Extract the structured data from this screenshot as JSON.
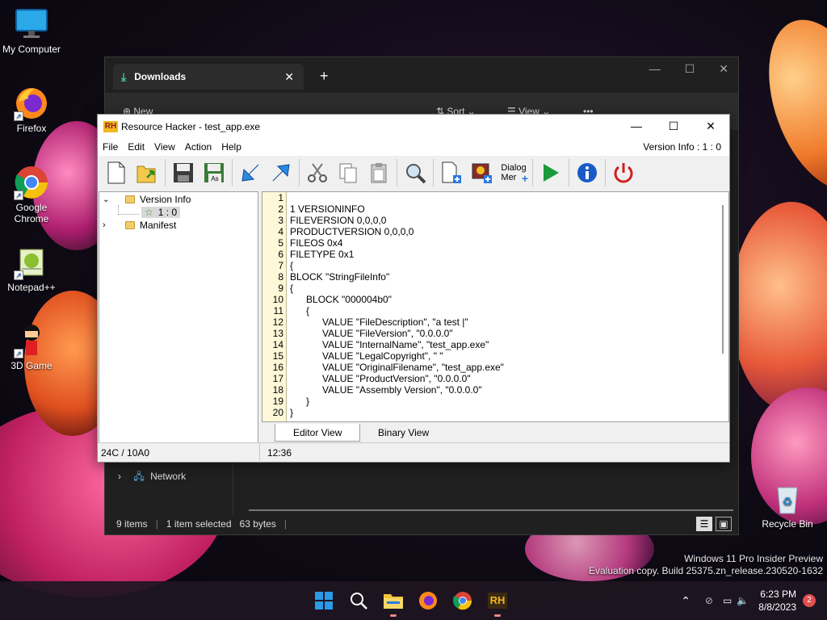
{
  "desktop": {
    "icons": [
      {
        "label": "My Computer"
      },
      {
        "label": "Firefox"
      },
      {
        "label": "Google Chrome"
      },
      {
        "label": "Notepad++"
      },
      {
        "label": "3D Game"
      },
      {
        "label": "Recycle Bin"
      }
    ],
    "watermark": {
      "line1": "Windows 11 Pro Insider Preview",
      "line2": "Evaluation copy. Build 25375.zn_release.230520-1632"
    }
  },
  "explorer": {
    "tab_title": "Downloads",
    "toolbar": {
      "new": "New",
      "sort": "Sort",
      "view": "View",
      "more": "•••"
    },
    "nav_network": "Network",
    "status": {
      "items": "9 items",
      "selected": "1 item selected",
      "size": "63 bytes"
    }
  },
  "rh": {
    "title": "Resource Hacker - test_app.exe",
    "logo": "RH",
    "menu": [
      "File",
      "Edit",
      "View",
      "Action",
      "Help"
    ],
    "version_info": "Version Info : 1 : 0",
    "toolbar": {
      "dialog_line1": "Dialog",
      "dialog_line2": "Mer"
    },
    "tree": {
      "version_info": "Version Info",
      "lang": "1 : 0",
      "manifest": "Manifest"
    },
    "line_numbers": [
      "1",
      "2",
      "3",
      "4",
      "5",
      "6",
      "7",
      "8",
      "9",
      "10",
      "11",
      "12",
      "13",
      "14",
      "15",
      "16",
      "17",
      "18",
      "19",
      "20"
    ],
    "code": [
      "",
      "1 VERSIONINFO",
      "FILEVERSION 0,0,0,0",
      "PRODUCTVERSION 0,0,0,0",
      "FILEOS 0x4",
      "FILETYPE 0x1",
      "{",
      "BLOCK \"StringFileInfo\"",
      "{",
      "\tBLOCK \"000004b0\"",
      "\t{",
      "\t\tVALUE \"FileDescription\", \"a test |\"",
      "\t\tVALUE \"FileVersion\", \"0.0.0.0\"",
      "\t\tVALUE \"InternalName\", \"test_app.exe\"",
      "\t\tVALUE \"LegalCopyright\", \" \"",
      "\t\tVALUE \"OriginalFilename\", \"test_app.exe\"",
      "\t\tVALUE \"ProductVersion\", \"0.0.0.0\"",
      "\t\tVALUE \"Assembly Version\", \"0.0.0.0\"",
      "\t}",
      "}"
    ],
    "tabs": {
      "editor": "Editor View",
      "binary": "Binary View"
    },
    "status": {
      "left": "24C / 10A0",
      "right": "12:36"
    }
  },
  "taskbar": {
    "time": "6:23 PM",
    "date": "8/8/2023",
    "notifications": "2"
  }
}
